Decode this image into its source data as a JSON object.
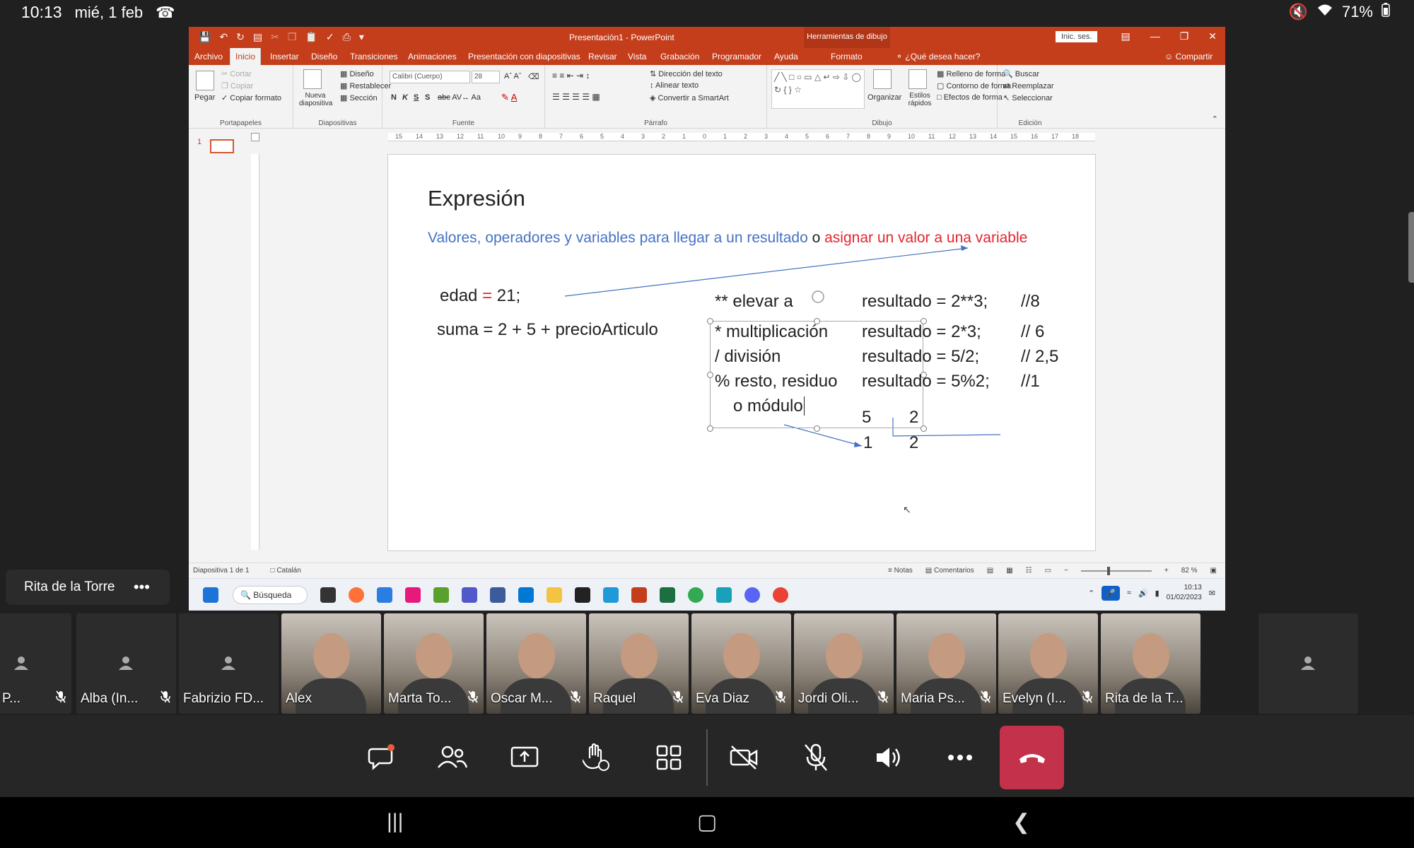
{
  "android": {
    "time": "10:13",
    "date": "mié, 1 feb",
    "battery": "71%"
  },
  "powerpoint": {
    "title": "Presentación1 - PowerPoint",
    "context_tools": "Herramientas de dibujo",
    "sign_in": "Inic. ses.",
    "tabs": [
      "Archivo",
      "Inicio",
      "Insertar",
      "Diseño",
      "Transiciones",
      "Animaciones",
      "Presentación con diapositivas",
      "Revisar",
      "Vista",
      "Grabación",
      "Programador",
      "Ayuda",
      "Formato"
    ],
    "active_tab": "Inicio",
    "tell_me": "¿Qué desea hacer?",
    "share": "Compartir",
    "ribbon": {
      "paste": "Pegar",
      "cut": "Cortar",
      "copy": "Copiar",
      "format_painter": "Copiar formato",
      "clipboard_group": "Portapapeles",
      "new_slide": "Nueva diapositiva",
      "layout": "Diseño",
      "reset": "Restablecer",
      "section": "Sección",
      "slides_group": "Diapositivas",
      "font_name": "Calibri (Cuerpo)",
      "font_size": "28",
      "font_group": "Fuente",
      "bold": "N",
      "italic": "K",
      "underline": "S",
      "shadow": "S",
      "text_direction": "Dirección del texto",
      "align_text": "Alinear texto",
      "smartart": "Convertir a SmartArt",
      "paragraph_group": "Párrafo",
      "arrange": "Organizar",
      "quick_styles": "Estilos rápidos",
      "shape_fill": "Relleno de forma",
      "shape_outline": "Contorno de forma",
      "shape_effects": "Efectos de forma",
      "drawing_group": "Dibujo",
      "find": "Buscar",
      "replace": "Reemplazar",
      "select": "Seleccionar",
      "editing_group": "Edición"
    },
    "ruler_labels": [
      "15",
      "14",
      "13",
      "12",
      "11",
      "10",
      "9",
      "8",
      "7",
      "6",
      "5",
      "4",
      "3",
      "2",
      "1",
      "0",
      "1",
      "2",
      "3",
      "4",
      "5",
      "6",
      "7",
      "8",
      "9",
      "10",
      "11",
      "12",
      "13",
      "14",
      "15",
      "16",
      "17",
      "18"
    ],
    "thumb_number": "1",
    "slide": {
      "title": "Expresión",
      "subtitle_blue": "Valores, operadores y variables para llegar a un resultado",
      "subtitle_mid": " o ",
      "subtitle_red": "asignar un valor a una variable",
      "edad_a": "edad ",
      "edad_eq": "=",
      "edad_b": " 21;",
      "suma": "suma = 2 + 5 + precioArticulo",
      "op_pow": "** elevar a",
      "op_mult": "* multiplicación",
      "op_div": "/ división",
      "op_mod": "% resto, residuo",
      "op_mod2": "o módulo",
      "res_pow": "resultado = 2**3;",
      "cmt_pow": "//8",
      "res_mult": "resultado = 2*3;",
      "cmt_mult": "// 6",
      "res_div": "resultado = 5/2;",
      "cmt_div": "// 2,5",
      "res_mod": "resultado = 5%2;",
      "cmt_mod": "//1",
      "div_dividend": "5",
      "div_divisor": "2",
      "div_remainder": "1",
      "div_quotient": "2"
    },
    "status": {
      "slide_of": "Diapositiva 1 de 1",
      "language": "Catalán",
      "notes": "Notas",
      "comments": "Comentarios",
      "zoom": "82 %",
      "zoom_level": 0.82
    }
  },
  "taskbar": {
    "search": "Búsqueda",
    "time": "10:13",
    "date": "01/02/2023"
  },
  "meeting": {
    "presenter": "Rita de la Torre",
    "participants": [
      {
        "name": "rgio P...",
        "video": false,
        "muted": true
      },
      {
        "name": "Alba  (In...",
        "video": false,
        "muted": true
      },
      {
        "name": "Fabrizio FD...",
        "video": false,
        "muted": false
      },
      {
        "name": "Alex",
        "video": true,
        "muted": false
      },
      {
        "name": "Marta To...",
        "video": true,
        "muted": true
      },
      {
        "name": "Oscar M...",
        "video": true,
        "muted": true
      },
      {
        "name": "Raquel",
        "video": true,
        "muted": true
      },
      {
        "name": "Eva Diaz",
        "video": true,
        "muted": true
      },
      {
        "name": "Jordi Oli...",
        "video": true,
        "muted": true
      },
      {
        "name": "Maria Ps...",
        "video": true,
        "muted": true
      },
      {
        "name": "Evelyn (I...",
        "video": true,
        "muted": true
      },
      {
        "name": "Rita de la T...",
        "video": true,
        "muted": false
      },
      {
        "name": "",
        "video": false,
        "muted": false
      }
    ]
  },
  "colors": {
    "ppt_red": "#c43e1c",
    "hangup_red": "#c4314b",
    "slide_blue": "#4472c4",
    "slide_red": "#e3262e"
  }
}
